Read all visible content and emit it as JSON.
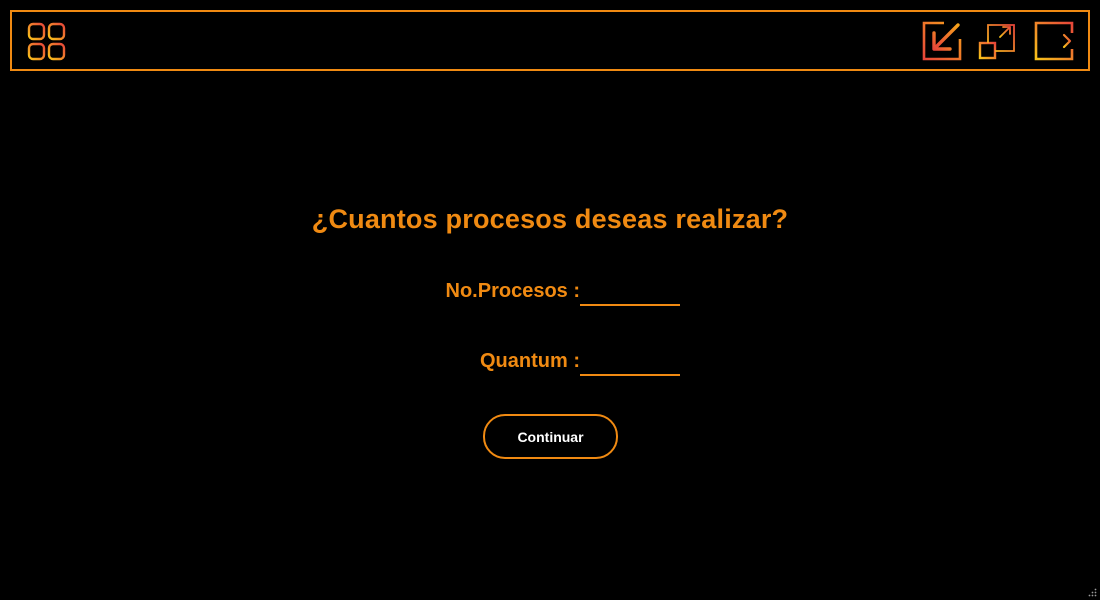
{
  "colors": {
    "accent": "#f08a12",
    "accent_red": "#e8463a",
    "accent_yellow": "#f7c21a",
    "background": "#000000",
    "button_text": "#ffffff"
  },
  "topbar": {
    "menu_icon": "grid-menu-icon",
    "icons": [
      "minimize-arrow-icon",
      "maximize-window-icon",
      "exit-icon"
    ]
  },
  "main": {
    "title": "¿Cuantos procesos deseas realizar?",
    "fields": {
      "procesos": {
        "label": "No.Procesos :",
        "value": ""
      },
      "quantum": {
        "label": "Quantum :",
        "value": ""
      }
    },
    "continue_label": "Continuar"
  }
}
